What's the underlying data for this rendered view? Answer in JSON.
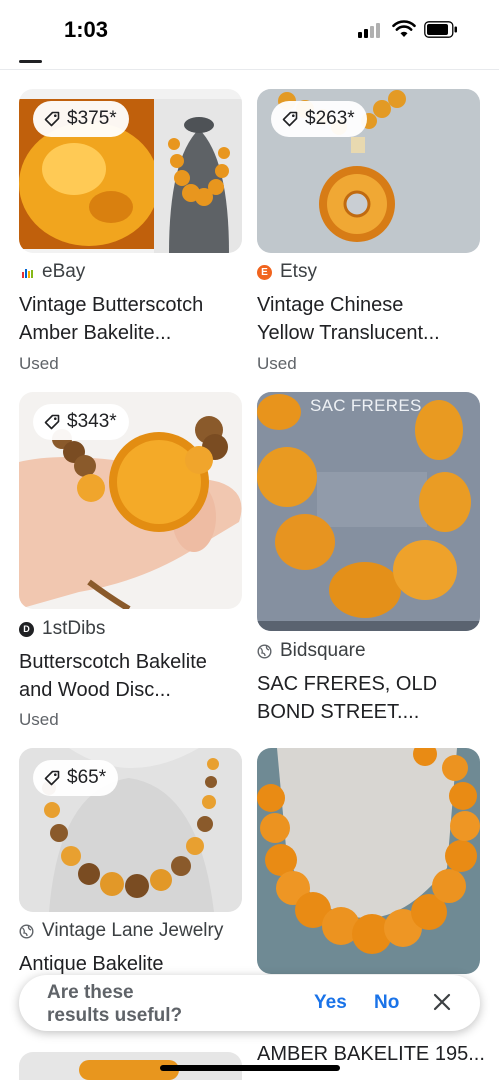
{
  "status_bar": {
    "time": "1:03"
  },
  "results": [
    {
      "price": "$375*",
      "source": "eBay",
      "title_lines": [
        "Vintage Butterscotch",
        "Amber Bakelite..."
      ],
      "condition": "Used"
    },
    {
      "price": "$263*",
      "source": "Etsy",
      "title_lines": [
        "Vintage Chinese",
        "Yellow Translucent..."
      ],
      "condition": "Used"
    },
    {
      "price": "$343*",
      "source": "1stDibs",
      "title_lines": [
        "Butterscotch Bakelite",
        "and Wood Disc..."
      ],
      "condition": "Used"
    },
    {
      "image_text": "SAC FRERES",
      "source": "Bidsquare",
      "title_lines": [
        "SAC FRERES, OLD",
        "BOND STREET...."
      ]
    },
    {
      "price": "$65*",
      "source": "Vintage Lane Jewelry",
      "title_lines": [
        "Antique Bakelite"
      ]
    },
    {
      "title_lines": [
        "AMBER BAKELITE 195..."
      ]
    }
  ],
  "feedback": {
    "question": "Are these results useful?",
    "question_line1": "Are these",
    "question_line2": "results useful?",
    "yes": "Yes",
    "no": "No"
  },
  "icons": {
    "tag": "tag-icon",
    "close": "close-icon",
    "globe": "globe-icon",
    "wifi": "wifi-icon",
    "battery": "battery-icon"
  },
  "colors": {
    "accent": "#1a73e8",
    "amber": "#e8961e",
    "etsy": "#f1641e"
  }
}
